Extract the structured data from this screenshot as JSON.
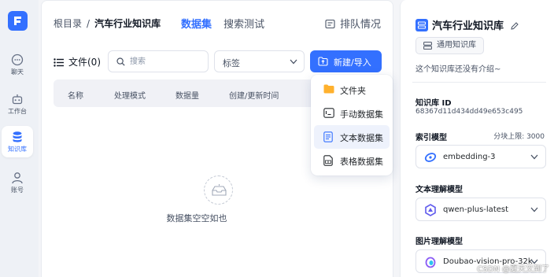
{
  "nav": {
    "items": [
      {
        "label": "聊天"
      },
      {
        "label": "工作台"
      },
      {
        "label": "知识库"
      },
      {
        "label": "账号"
      }
    ]
  },
  "breadcrumb": {
    "root": "根目录",
    "separator": "/",
    "current": "汽车行业知识库"
  },
  "tabs": [
    {
      "label": "数据集",
      "active": true
    },
    {
      "label": "搜索测试",
      "active": false
    }
  ],
  "queue_label": "排队情况",
  "toolbar": {
    "files_label": "文件(0)",
    "search_placeholder": "搜索",
    "tag_select_value": "标签",
    "new_import_label": "新建/导入"
  },
  "table": {
    "columns": [
      "名称",
      "处理模式",
      "数据量",
      "创建/更新时间"
    ]
  },
  "empty_text": "数据集空空如也",
  "menu": {
    "items": [
      {
        "label": "文件夹",
        "icon": "folder-icon"
      },
      {
        "label": "手动数据集",
        "icon": "manual-dataset-icon"
      },
      {
        "label": "文本数据集",
        "icon": "text-dataset-icon"
      },
      {
        "label": "表格数据集",
        "icon": "table-dataset-icon"
      }
    ]
  },
  "kb": {
    "title": "汽车行业知识库",
    "type_label": "通用知识库",
    "intro": "这个知识库还没有介绍~",
    "id_label": "知识库 ID",
    "id_value": "68367d11d434dd49e653c495",
    "index_model_label": "索引模型",
    "chunk_limit": "分块上限: 3000",
    "index_model": "embedding-3",
    "text_model_label": "文本理解模型",
    "text_model": "qwen-plus-latest",
    "image_model_label": "图片理解模型",
    "image_model": "Doubao-vision-pro-32k"
  },
  "watermark": "CSDN @夏天又到了",
  "colors": {
    "accent": "#3370ff",
    "menu_hover": "#eef2fc",
    "nav_bg": "#eef1f6"
  }
}
